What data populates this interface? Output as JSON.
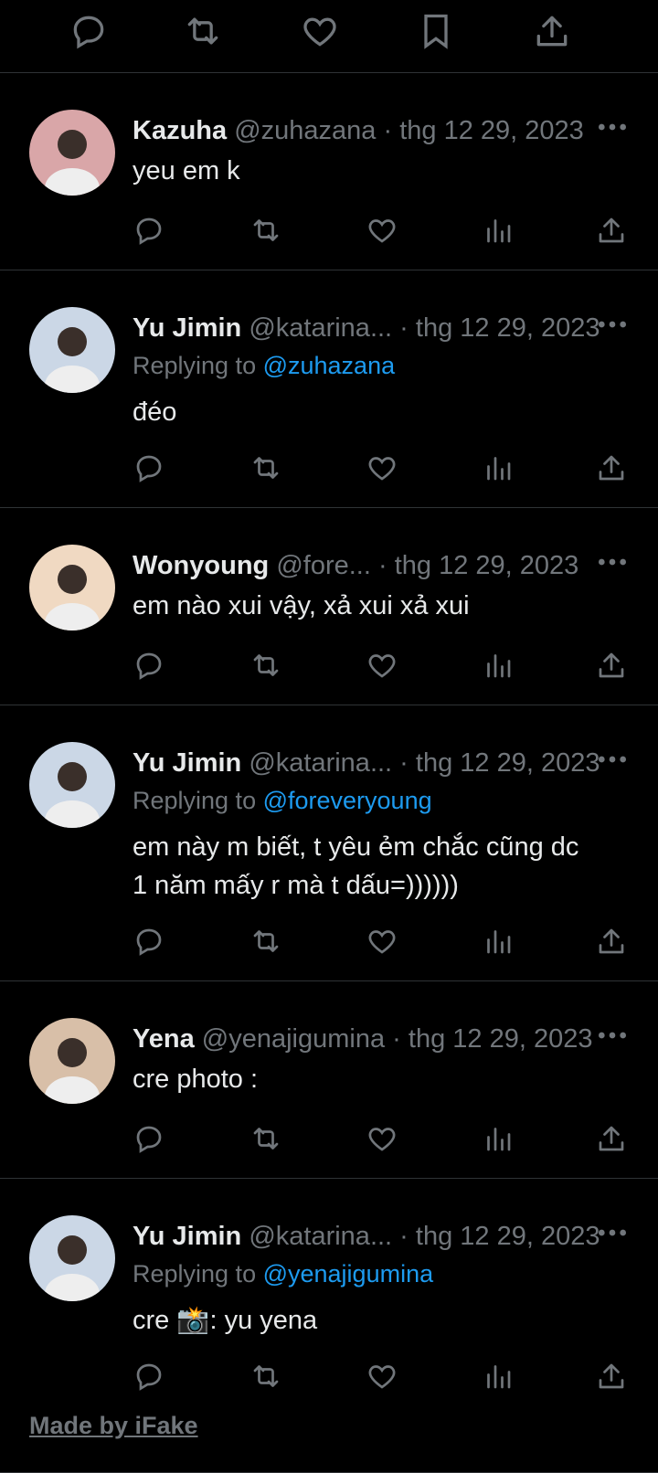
{
  "top_actions": [
    "reply-icon",
    "retweet-icon",
    "like-icon",
    "bookmark-icon",
    "share-icon"
  ],
  "tweets": [
    {
      "name": "Kazuha",
      "handle": "@zuhazana",
      "date": "thg 12 29, 2023",
      "reply_prefix": "",
      "reply_to": "",
      "text": "yeu em k",
      "avatar_color": "#d9a6a8"
    },
    {
      "name": "Yu Jimin",
      "handle": "@katarina...",
      "date": "thg 12 29, 2023",
      "reply_prefix": "Replying to ",
      "reply_to": "@zuhazana",
      "text": "đéo",
      "avatar_color": "#cbd7e6"
    },
    {
      "name": "Wonyoung",
      "handle": "@fore...",
      "date": "thg 12 29, 2023",
      "reply_prefix": "",
      "reply_to": "",
      "text": "em nào xui vậy, xả xui xả xui",
      "avatar_color": "#f0d9c2"
    },
    {
      "name": "Yu Jimin",
      "handle": "@katarina...",
      "date": "thg 12 29, 2023",
      "reply_prefix": "Replying to ",
      "reply_to": "@foreveryoung",
      "text": "em này m biết, t yêu ẻm chắc cũng dc\n1 năm mấy r mà t dấu=))))))",
      "avatar_color": "#cbd7e6"
    },
    {
      "name": "Yena",
      "handle": "@yenajigumina",
      "date": "thg 12 29, 2023",
      "reply_prefix": "",
      "reply_to": "",
      "text": "cre photo :",
      "avatar_color": "#d8bfa8"
    },
    {
      "name": "Yu Jimin",
      "handle": "@katarina...",
      "date": "thg 12 29, 2023",
      "reply_prefix": "Replying to ",
      "reply_to": "@yenajigumina",
      "text": "cre 📸: yu yena",
      "avatar_color": "#cbd7e6"
    }
  ],
  "separator": " · ",
  "watermark": "Made by iFake",
  "colors": {
    "background": "#000000",
    "text": "#e7e9ea",
    "muted": "#71767b",
    "link": "#1d9bf0",
    "divider": "#2f3336"
  }
}
